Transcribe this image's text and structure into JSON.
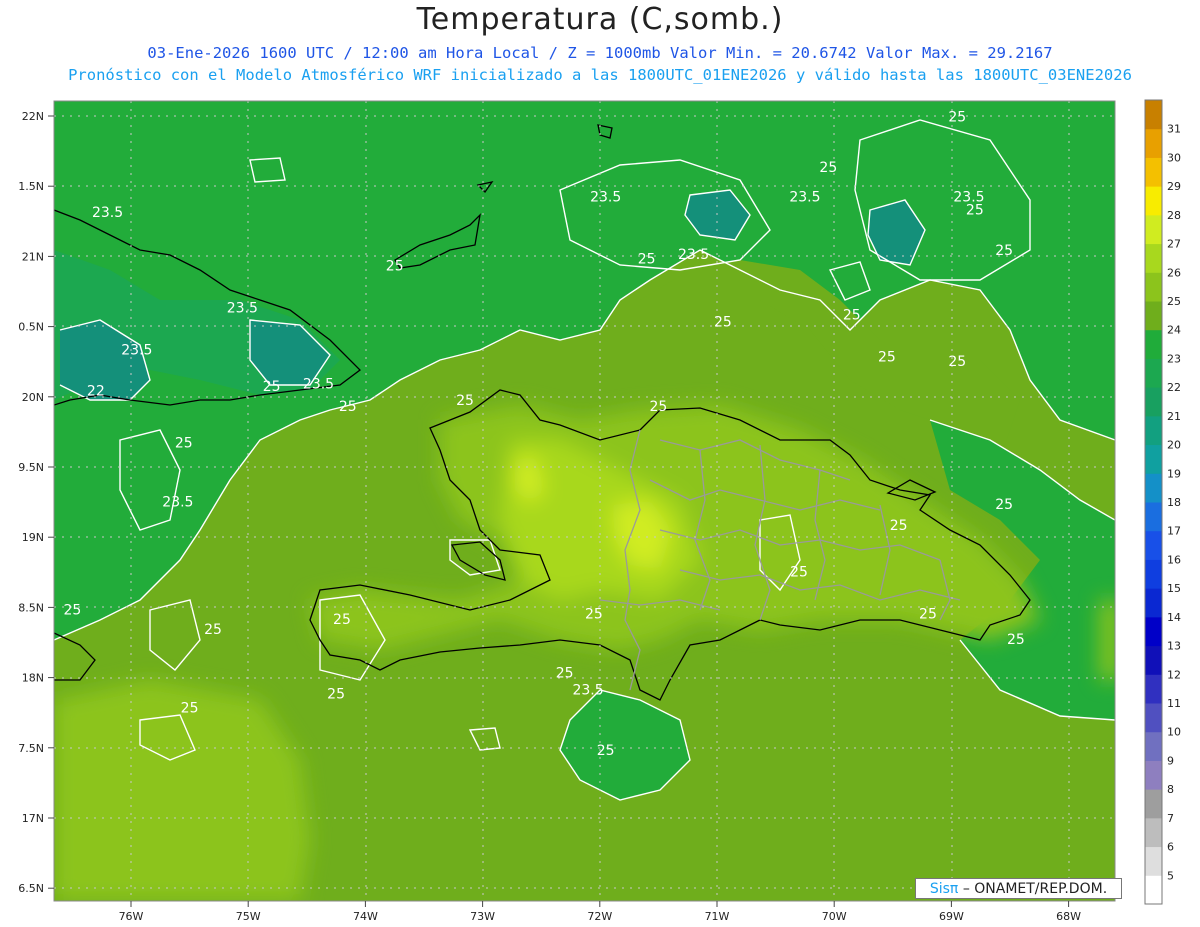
{
  "title": "Temperatura (C,somb.)",
  "subtitle_line1": "03-Ene-2026 1600 UTC / 12:00 am Hora Local / Z = 1000mb  Valor Min. = 20.6742  Valor Max. = 29.2167",
  "subtitle_line2": "Pronóstico con el Modelo Atmosférico WRF inicializado a las 1800UTC_01ENE2026 y válido hasta las  1800UTC_03ENE2026",
  "credit": {
    "brand": "Sisπ",
    "org": "– ONAMET/REP.DOM."
  },
  "chart_data": {
    "type": "heatmap",
    "lat_labels": [
      "22N",
      "1.5N",
      "21N",
      "0.5N",
      "20N",
      "9.5N",
      "19N",
      "8.5N",
      "18N",
      "7.5N",
      "17N",
      "6.5N"
    ],
    "lon_labels": [
      "76W",
      "75W",
      "74W",
      "73W",
      "72W",
      "71W",
      "70W",
      "69W",
      "68W"
    ],
    "lat_range": [
      16.5,
      22.0
    ],
    "lon_range": [
      -76.6,
      -67.6
    ],
    "min_value": 20.6742,
    "max_value": 29.2167,
    "colorbar": {
      "levels": [
        5,
        6,
        7,
        8,
        9,
        10,
        11,
        12,
        13,
        14,
        15,
        16,
        17,
        18,
        19,
        20,
        21,
        22,
        23,
        24,
        25,
        26,
        27,
        28,
        29,
        30,
        31
      ],
      "colors": [
        "#ffffff",
        "#dedede",
        "#bdbdbd",
        "#9e9e9e",
        "#8e7fbf",
        "#7070c0",
        "#5050c0",
        "#3030c0",
        "#1010b8",
        "#0000c8",
        "#0a28d2",
        "#0f3ee0",
        "#1850e8",
        "#1a6ee0",
        "#1490c8",
        "#10a0a0",
        "#12a080",
        "#18a060",
        "#1ca850",
        "#20ac3a",
        "#6fae1c",
        "#8cc41c",
        "#a8d81e",
        "#d0ec20",
        "#f8ec00",
        "#f4c000",
        "#e8a000",
        "#c88000"
      ]
    },
    "contour_labels": [
      {
        "value": "25",
        "lon": -68.95,
        "lat": 21.96
      },
      {
        "value": "23.5",
        "lon": -76.2,
        "lat": 21.28
      },
      {
        "value": "23.5",
        "lon": -71.95,
        "lat": 21.39
      },
      {
        "value": "23.5",
        "lon": -71.2,
        "lat": 20.98
      },
      {
        "value": "23.5",
        "lon": -70.25,
        "lat": 21.39
      },
      {
        "value": "23.5",
        "lon": -68.85,
        "lat": 21.39
      },
      {
        "value": "25",
        "lon": -70.05,
        "lat": 21.6
      },
      {
        "value": "25",
        "lon": -68.8,
        "lat": 21.3
      },
      {
        "value": "25",
        "lon": -68.55,
        "lat": 21.01
      },
      {
        "value": "25",
        "lon": -73.75,
        "lat": 20.9
      },
      {
        "value": "25",
        "lon": -71.6,
        "lat": 20.95
      },
      {
        "value": "25",
        "lon": -69.85,
        "lat": 20.55
      },
      {
        "value": "25",
        "lon": -70.95,
        "lat": 20.5
      },
      {
        "value": "23.5",
        "lon": -75.05,
        "lat": 20.6
      },
      {
        "value": "23.5",
        "lon": -75.95,
        "lat": 20.3
      },
      {
        "value": "23.5",
        "lon": -74.4,
        "lat": 20.06
      },
      {
        "value": "22",
        "lon": -76.3,
        "lat": 20.01
      },
      {
        "value": "25",
        "lon": -74.8,
        "lat": 20.04
      },
      {
        "value": "25",
        "lon": -74.15,
        "lat": 19.9
      },
      {
        "value": "25",
        "lon": -69.55,
        "lat": 20.25
      },
      {
        "value": "25",
        "lon": -68.95,
        "lat": 20.22
      },
      {
        "value": "25",
        "lon": -73.15,
        "lat": 19.94
      },
      {
        "value": "25",
        "lon": -71.5,
        "lat": 19.9
      },
      {
        "value": "25",
        "lon": -75.55,
        "lat": 19.64
      },
      {
        "value": "23.5",
        "lon": -75.6,
        "lat": 19.22
      },
      {
        "value": "25",
        "lon": -68.55,
        "lat": 19.2
      },
      {
        "value": "25",
        "lon": -69.45,
        "lat": 19.05
      },
      {
        "value": "25",
        "lon": -70.3,
        "lat": 18.72
      },
      {
        "value": "25",
        "lon": -76.5,
        "lat": 18.45
      },
      {
        "value": "25",
        "lon": -75.3,
        "lat": 18.31
      },
      {
        "value": "25",
        "lon": -74.2,
        "lat": 18.38
      },
      {
        "value": "25",
        "lon": -72.05,
        "lat": 18.42
      },
      {
        "value": "25",
        "lon": -69.2,
        "lat": 18.42
      },
      {
        "value": "25",
        "lon": -68.45,
        "lat": 18.24
      },
      {
        "value": "25",
        "lon": -72.3,
        "lat": 18.0
      },
      {
        "value": "23.5",
        "lon": -72.1,
        "lat": 17.88
      },
      {
        "value": "25",
        "lon": -74.25,
        "lat": 17.85
      },
      {
        "value": "25",
        "lon": -75.5,
        "lat": 17.75
      },
      {
        "value": "25",
        "lon": -71.95,
        "lat": 17.45
      }
    ]
  }
}
